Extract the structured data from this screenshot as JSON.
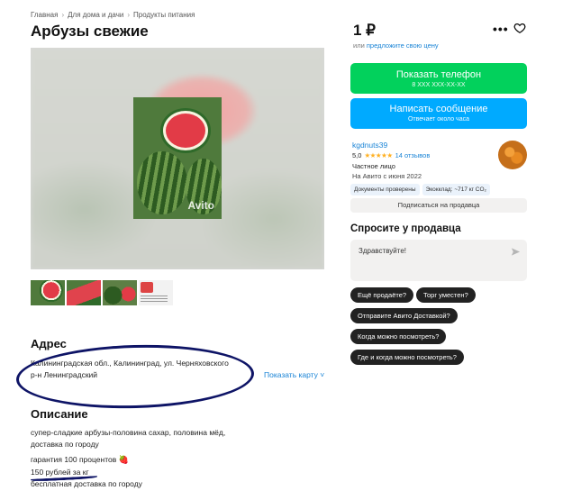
{
  "breadcrumb": [
    "Главная",
    "Для дома и дачи",
    "Продукты питания"
  ],
  "title": "Арбузы свежие",
  "gallery": {
    "watermark": "Avito"
  },
  "address": {
    "heading": "Адрес",
    "line1": "Калининградская обл., Калининград, ул. Черняховского",
    "line2": "р-н Ленинградский",
    "map_link": "Показать карту ˅"
  },
  "description": {
    "heading": "Описание",
    "lines": [
      "супер-сладкие арбузы-половина сахар, половина мёд,",
      "доставка по городу",
      "гарантия 100 процентов",
      "150 рублей за кг",
      "бесплатная доставка по городу"
    ],
    "emoji": "🍓"
  },
  "price": {
    "value": "1 ₽",
    "prefix": "или",
    "offer_link": "предложите свою цену"
  },
  "buttons": {
    "phone_label": "Показать телефон",
    "phone_sub": "8 XXX XXX-XX-XX",
    "message_label": "Написать сообщение",
    "message_sub": "Отвечает около часа"
  },
  "seller": {
    "name": "kgdnuts39",
    "rating": "5,0",
    "stars": "★★★★★",
    "reviews": "14 отзывов",
    "type": "Частное лицо",
    "since": "На Авито с июня 2022",
    "badges": [
      "Документы проверены",
      "Экокклад: ~717 кг CO₂"
    ],
    "subscribe": "Подписаться на продавца"
  },
  "ask": {
    "heading": "Спросите у продавца",
    "input_value": "Здравствуйте!",
    "chips": [
      "Ещё продаёте?",
      "Торг уместен?",
      "Отправите Авито Доставкой?",
      "Когда можно посмотреть?",
      "Где и когда можно посмотреть?"
    ]
  },
  "colors": {
    "green_button": "#02d15c",
    "blue_button": "#00aaff",
    "link": "#1a84d6",
    "annotation": "#0e1466"
  }
}
